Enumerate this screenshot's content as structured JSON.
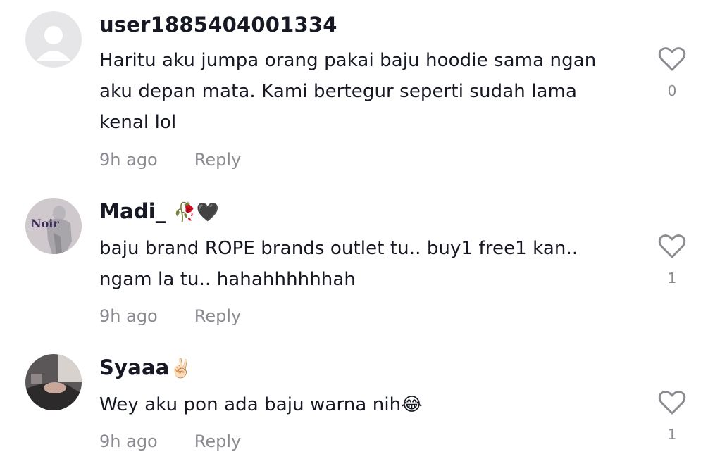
{
  "comments": [
    {
      "username": "user1885404001334",
      "text_lines": [
        "Haritu aku jumpa orang pakai baju hoodie sama ngan",
        "aku depan mata. Kami bertegur seperti sudah lama",
        "kenal lol"
      ],
      "time": "9h ago",
      "reply": "Reply",
      "likes": "0",
      "avatar": "default-avatar-icon"
    },
    {
      "username": "Madi_",
      "username_emoji": "🥀🖤",
      "text_lines": [
        "baju brand ROPE brands outlet tu.. buy1 free1 kan..",
        "ngam la tu.. hahahhhhhhah"
      ],
      "time": "9h ago",
      "reply": "Reply",
      "likes": "1",
      "avatar": "user-photo-avatar",
      "avatar_text": "Noir"
    },
    {
      "username": "Syaaa",
      "username_emoji": "✌🏻",
      "text_lines": [
        "Wey aku pon ada baju warna nih😂"
      ],
      "time": "9h ago",
      "reply": "Reply",
      "likes": "1",
      "avatar": "user-photo-avatar"
    }
  ],
  "colors": {
    "text": "#161823",
    "muted": "#8a8b91",
    "avatar_default_bg": "#e3e3e5"
  }
}
